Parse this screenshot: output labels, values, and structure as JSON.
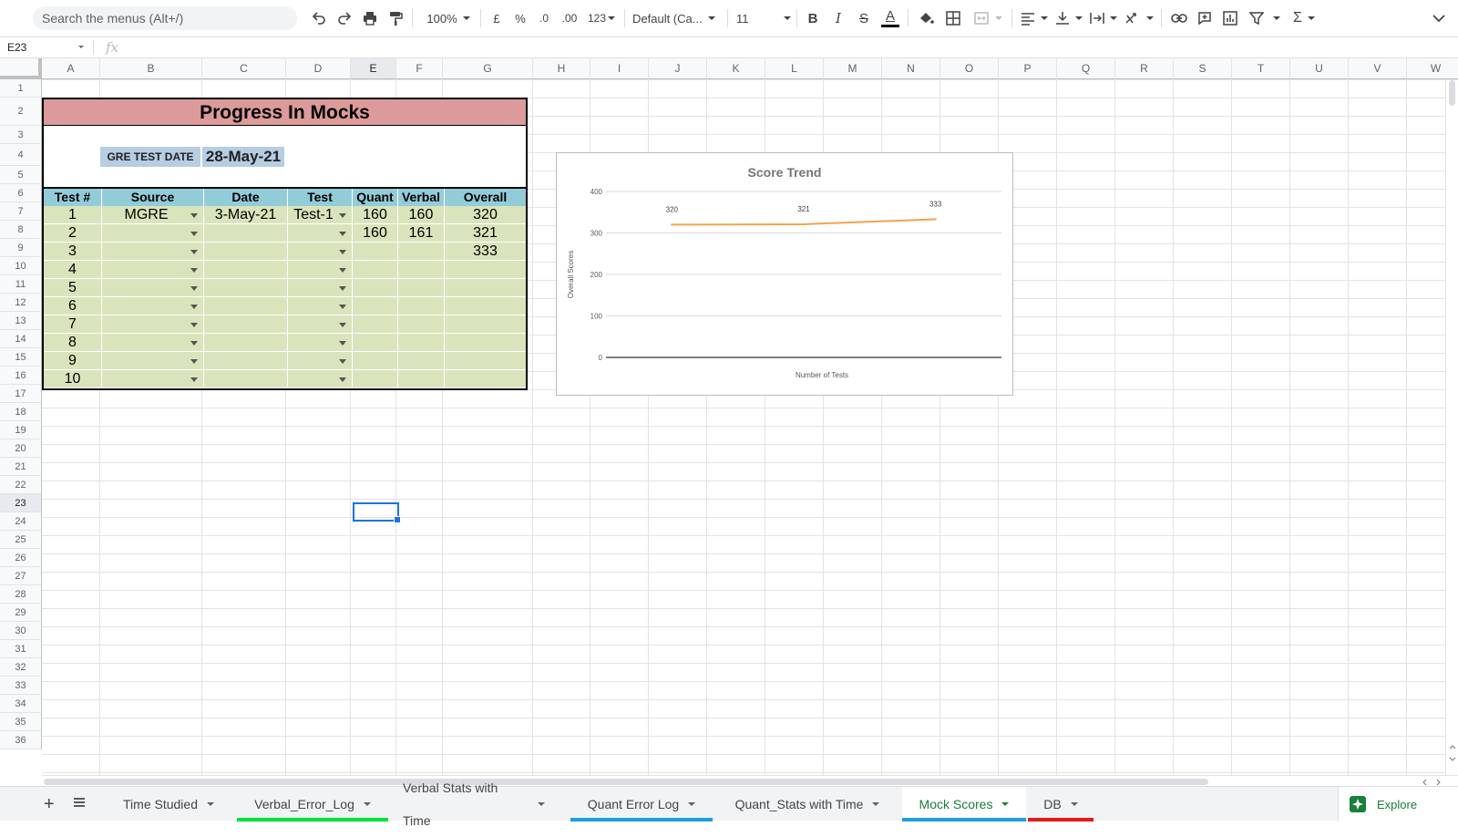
{
  "toolbar": {
    "search_placeholder": "Search the menus (Alt+/)",
    "zoom": "100%",
    "currency": "£",
    "percent": "%",
    "dec_decrease": ".0",
    "dec_increase": ".00",
    "more_formats": "123",
    "font": "Default (Ca...",
    "font_size": "11",
    "bold": "B",
    "italic": "I",
    "strike": "S",
    "text_color": "A",
    "sum": "Σ"
  },
  "formula_bar": {
    "cell_ref": "E23",
    "fx": "fx",
    "value": ""
  },
  "columns": [
    "A",
    "B",
    "C",
    "D",
    "E",
    "F",
    "G",
    "H",
    "I",
    "J",
    "K",
    "L",
    "M",
    "N",
    "O",
    "P",
    "Q",
    "R",
    "S",
    "T",
    "U",
    "V",
    "W"
  ],
  "rows": [
    "1",
    "2",
    "3",
    "4",
    "5",
    "6",
    "7",
    "8",
    "9",
    "10",
    "11",
    "12",
    "13",
    "14",
    "15",
    "16",
    "17",
    "18",
    "19",
    "20",
    "21",
    "22",
    "23",
    "24",
    "25",
    "26",
    "27",
    "28",
    "29",
    "30",
    "31",
    "32",
    "33",
    "34",
    "35",
    "36"
  ],
  "selected": {
    "column": "E",
    "row": "23"
  },
  "sheet": {
    "title": "Progress In Mocks",
    "gre_label": "GRE TEST DATE",
    "gre_date": "28-May-21",
    "headers": [
      "Test #",
      "Source",
      "Date",
      "Test",
      "Quant",
      "Verbal",
      "Overall Score"
    ],
    "rows": [
      {
        "n": "1",
        "source": "MGRE",
        "date": "3-May-21",
        "test": "Test-1",
        "quant": "160",
        "verbal": "160",
        "overall": "320"
      },
      {
        "n": "2",
        "source": "",
        "date": "",
        "test": "",
        "quant": "160",
        "verbal": "161",
        "overall": "321"
      },
      {
        "n": "3",
        "source": "",
        "date": "",
        "test": "",
        "quant": "",
        "verbal": "",
        "overall": "333"
      },
      {
        "n": "4",
        "source": "",
        "date": "",
        "test": "",
        "quant": "",
        "verbal": "",
        "overall": ""
      },
      {
        "n": "5",
        "source": "",
        "date": "",
        "test": "",
        "quant": "",
        "verbal": "",
        "overall": ""
      },
      {
        "n": "6",
        "source": "",
        "date": "",
        "test": "",
        "quant": "",
        "verbal": "",
        "overall": ""
      },
      {
        "n": "7",
        "source": "",
        "date": "",
        "test": "",
        "quant": "",
        "verbal": "",
        "overall": ""
      },
      {
        "n": "8",
        "source": "",
        "date": "",
        "test": "",
        "quant": "",
        "verbal": "",
        "overall": ""
      },
      {
        "n": "9",
        "source": "",
        "date": "",
        "test": "",
        "quant": "",
        "verbal": "",
        "overall": ""
      },
      {
        "n": "10",
        "source": "",
        "date": "",
        "test": "",
        "quant": "",
        "verbal": "",
        "overall": ""
      }
    ]
  },
  "chart_data": {
    "type": "line",
    "title": "Score Trend",
    "xlabel": "Number of Tests",
    "ylabel": "Overall Scores",
    "ylim": [
      0,
      400
    ],
    "yticks": [
      "0",
      "100",
      "200",
      "300",
      "400"
    ],
    "x": [
      1,
      2,
      3
    ],
    "series": [
      {
        "values": [
          320,
          321,
          333
        ],
        "labels": [
          "320",
          "321",
          "333"
        ],
        "color": "#f4a24b"
      }
    ],
    "grid": true
  },
  "tabs": [
    {
      "label": "Time Studied",
      "color": ""
    },
    {
      "label": "Verbal_Error_Log",
      "color": "#00e23a"
    },
    {
      "label": "Verbal Stats with Time",
      "color": ""
    },
    {
      "label": "Quant Error Log",
      "color": "#1c9fe1"
    },
    {
      "label": "Quant_Stats with Time",
      "color": ""
    },
    {
      "label": "Mock Scores",
      "color": "#1c9fe1"
    },
    {
      "label": "DB",
      "color": "#e31b1b"
    }
  ],
  "active_tab": "Mock Scores",
  "explore_label": "Explore",
  "colors": {
    "title_band": "#dc9b9a",
    "header_band": "#93ccd9",
    "body_band": "#d9e4bc",
    "gre_band": "#b7cde2",
    "selection": "#1a73e8",
    "active_tab_text": "#188038"
  }
}
